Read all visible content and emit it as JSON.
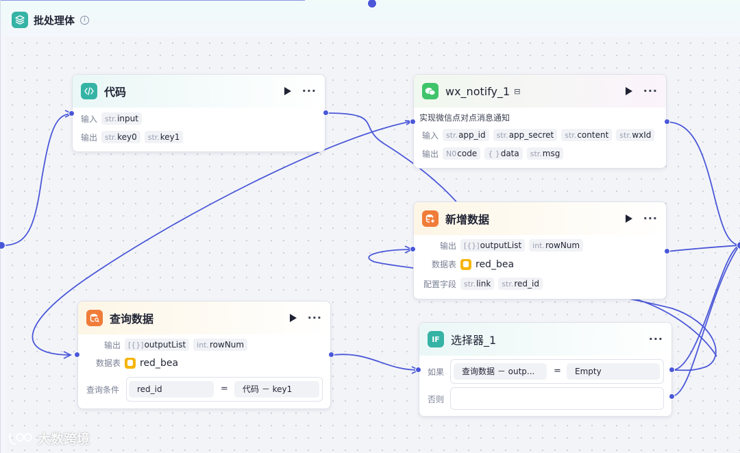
{
  "header": {
    "title": "批处理体",
    "info_icon": "info-icon"
  },
  "colors": {
    "accent": "#4a57d8",
    "code_icon": "#35b3a5",
    "wechat": "#3fc46a",
    "db_orange": "#f07c3a",
    "if_teal": "#35b3a5"
  },
  "nodes": {
    "code": {
      "title": "代码",
      "rows": [
        {
          "label": "输入",
          "tags": [
            {
              "type": "str.",
              "name": "input"
            }
          ]
        },
        {
          "label": "输出",
          "tags": [
            {
              "type": "str.",
              "name": "key0"
            },
            {
              "type": "str.",
              "name": "key1"
            }
          ]
        }
      ]
    },
    "wx": {
      "title": "wx_notify_1",
      "description": "实现微信点对点消息通知",
      "rows": [
        {
          "label": "输入",
          "tags": [
            {
              "type": "str.",
              "name": "app_id"
            },
            {
              "type": "str.",
              "name": "app_secret"
            },
            {
              "type": "str.",
              "name": "content"
            },
            {
              "type": "str.",
              "name": "wxId"
            }
          ]
        },
        {
          "label": "输出",
          "tags": [
            {
              "type": "N0",
              "name": "code"
            },
            {
              "type": "{ }",
              "name": "data"
            },
            {
              "type": "str.",
              "name": "msg"
            }
          ]
        }
      ]
    },
    "add": {
      "title": "新增数据",
      "output_label": "输出",
      "outputs": [
        {
          "type": "[{}]",
          "name": "outputList"
        },
        {
          "type": "int.",
          "name": "rowNum"
        }
      ],
      "table_label": "数据表",
      "table": "red_bea",
      "fields_label": "配置字段",
      "fields": [
        {
          "type": "str.",
          "name": "link"
        },
        {
          "type": "str.",
          "name": "red_id"
        }
      ]
    },
    "query": {
      "title": "查询数据",
      "output_label": "输出",
      "outputs": [
        {
          "type": "[{}]",
          "name": "outputList"
        },
        {
          "type": "int.",
          "name": "rowNum"
        }
      ],
      "table_label": "数据表",
      "table": "red_bea",
      "cond_label": "查询条件",
      "cond_left": "red_id",
      "cond_op": "=",
      "cond_right": "代码 － key1"
    },
    "selector": {
      "title": "选择器_1",
      "icon_text": "IF",
      "if_label": "如果",
      "if_left": "查询数据 － outp...",
      "if_op": "=",
      "if_right": "Empty",
      "else_label": "否则",
      "else_value": ""
    }
  },
  "watermark": "大数跨境"
}
